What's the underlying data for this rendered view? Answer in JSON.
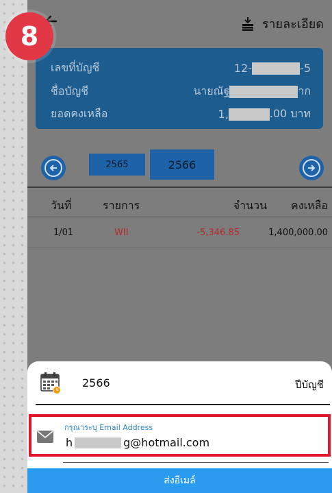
{
  "step_badge": "8",
  "header": {
    "detail_label": "รายละเอียด"
  },
  "account": {
    "number_label": "เลขที่บัญชี",
    "number_prefix": "12-",
    "number_suffix": "-5",
    "name_label": "ชื่อบัญชี",
    "name_prefix": "นายณัฐ",
    "name_suffix": "าก",
    "balance_label": "ยอดคงเหลือ",
    "balance_prefix": "1,",
    "balance_suffix": ".00 บาท"
  },
  "years": {
    "previous": "2565",
    "current": "2566"
  },
  "table": {
    "headers": [
      "วันที่",
      "รายการ",
      "จำนวน",
      "คงเหลือ"
    ],
    "rows": [
      {
        "date": "1/01",
        "item": "WII",
        "amount": "-5,346.85",
        "balance": "1,400,000.00"
      }
    ]
  },
  "sheet": {
    "year_value": "2566",
    "fiscal_label": "ปีบัญชี",
    "email_label": "กรุณาระบุ Email Address",
    "email_prefix": "h",
    "email_suffix": "g@hotmail.com",
    "send_label": "ส่งอีเมล์"
  },
  "colors": {
    "badge": "#e23744",
    "card": "#1c5c8e",
    "year_chip": "#1e63a8",
    "negative_amount": "#b52b2b",
    "highlight_border": "#e2162b",
    "send_button": "#2b9bf0",
    "email_label": "#2a84c8"
  },
  "icons": [
    "back-arrow-icon",
    "download-detail-icon",
    "arrow-left-icon",
    "arrow-right-icon",
    "calendar-icon",
    "mail-icon"
  ]
}
